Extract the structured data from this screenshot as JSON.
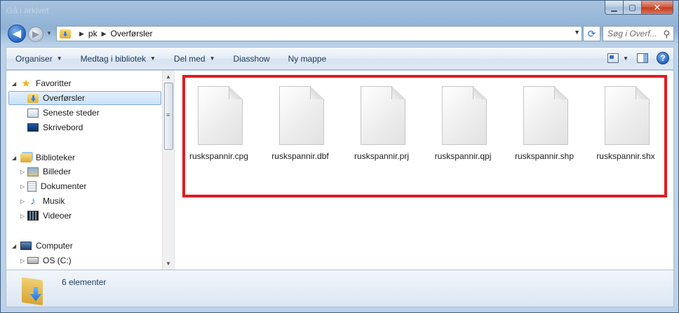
{
  "window": {
    "ghost_title": "Gå i arkivet",
    "controls": {
      "minimize": "▁",
      "maximize": "▢",
      "close": "✕"
    }
  },
  "navigation": {
    "back_glyph": "◀",
    "forward_glyph": "▶",
    "breadcrumbs": [
      "pk",
      "Overførsler"
    ],
    "refresh_glyph": "⟳",
    "search_placeholder": "Søg i Overf...",
    "search_icon": "search-icon"
  },
  "command_bar": {
    "items": [
      {
        "label": "Organiser",
        "has_caret": true
      },
      {
        "label": "Medtag i bibliotek",
        "has_caret": true
      },
      {
        "label": "Del med",
        "has_caret": true
      },
      {
        "label": "Diasshow",
        "has_caret": false
      },
      {
        "label": "Ny mappe",
        "has_caret": false
      }
    ],
    "help_label": "?"
  },
  "sidebar": {
    "favorites": {
      "label": "Favoritter",
      "items": [
        {
          "label": "Overførsler",
          "icon": "downloads-folder-icon",
          "selected": true
        },
        {
          "label": "Seneste steder",
          "icon": "recent-places-icon",
          "selected": false
        },
        {
          "label": "Skrivebord",
          "icon": "desktop-icon",
          "selected": false
        }
      ]
    },
    "libraries": {
      "label": "Biblioteker",
      "items": [
        {
          "label": "Billeder",
          "icon": "pictures-icon"
        },
        {
          "label": "Dokumenter",
          "icon": "documents-icon"
        },
        {
          "label": "Musik",
          "icon": "music-icon"
        },
        {
          "label": "Videoer",
          "icon": "videos-icon"
        }
      ]
    },
    "computer": {
      "label": "Computer",
      "items": [
        {
          "label": "OS (C:)",
          "icon": "drive-icon"
        }
      ]
    }
  },
  "files": [
    {
      "name": "ruskspannir.cpg"
    },
    {
      "name": "ruskspannir.dbf"
    },
    {
      "name": "ruskspannir.prj"
    },
    {
      "name": "ruskspannir.qpj"
    },
    {
      "name": "ruskspannir.shp"
    },
    {
      "name": "ruskspannir.shx"
    }
  ],
  "details": {
    "count_text": "6 elementer"
  },
  "colors": {
    "highlight_border": "#e11b23",
    "accent": "#2264c4"
  }
}
